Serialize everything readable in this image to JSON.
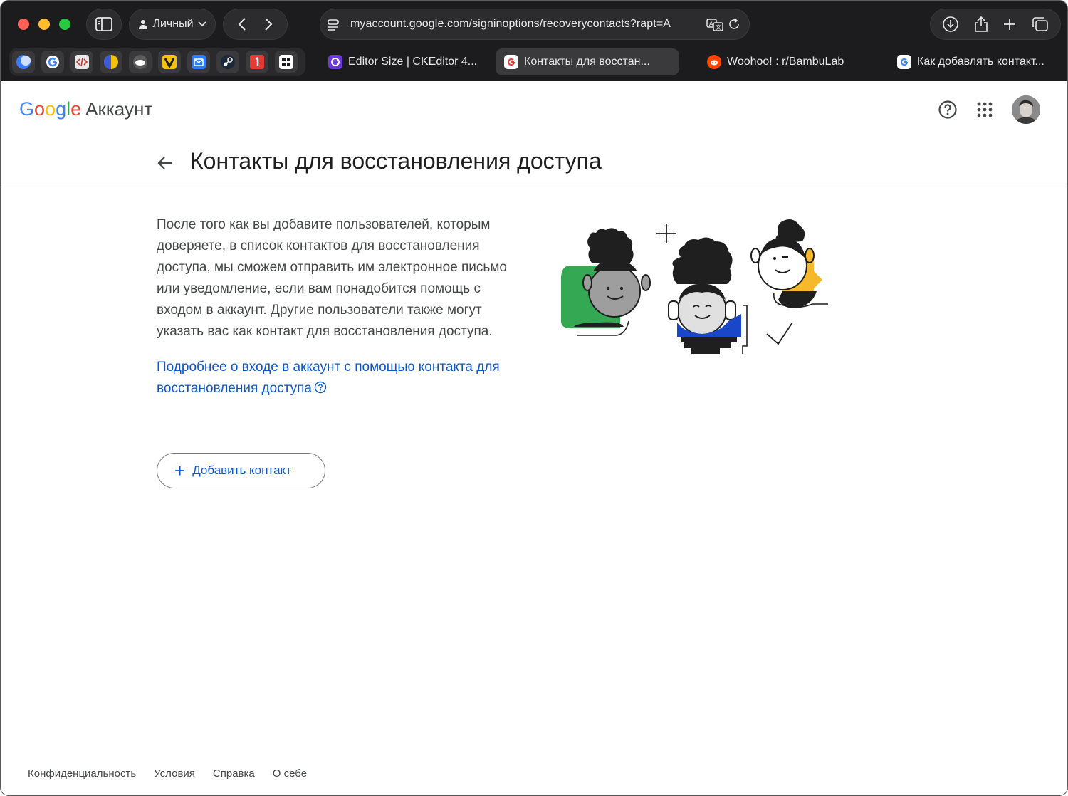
{
  "browser": {
    "profile_label": "Личный",
    "url": "myaccount.google.com/signinoptions/recoverycontacts?rapt=A",
    "tabs": [
      {
        "title": "Editor Size | CKEditor 4..."
      },
      {
        "title": "Контакты для восстан..."
      },
      {
        "title": "Woohoo! : r/BambuLab"
      },
      {
        "title": "Как добавлять контакт..."
      }
    ]
  },
  "header": {
    "logo_google": "Google",
    "logo_suffix": "Аккаунт"
  },
  "page": {
    "title": "Контакты для восстановления доступа",
    "description": "После того как вы добавите пользователей, которым доверяете, в список контактов для восстановления доступа, мы сможем отправить им электронное письмо или уведомление, если вам понадобится помощь с входом в аккаунт. Другие пользователи также могут указать вас как контакт для восстановления доступа.",
    "learn_more": "Подробнее о входе в аккаунт с помощью контакта для восстановления доступа",
    "add_button": "Добавить контакт"
  },
  "footer": {
    "links": [
      "Конфиденциальность",
      "Условия",
      "Справка",
      "О себе"
    ]
  },
  "colors": {
    "link": "#0b57d0",
    "green": "#34a853",
    "yellow": "#f6b92b",
    "blue": "#1a47c7"
  }
}
